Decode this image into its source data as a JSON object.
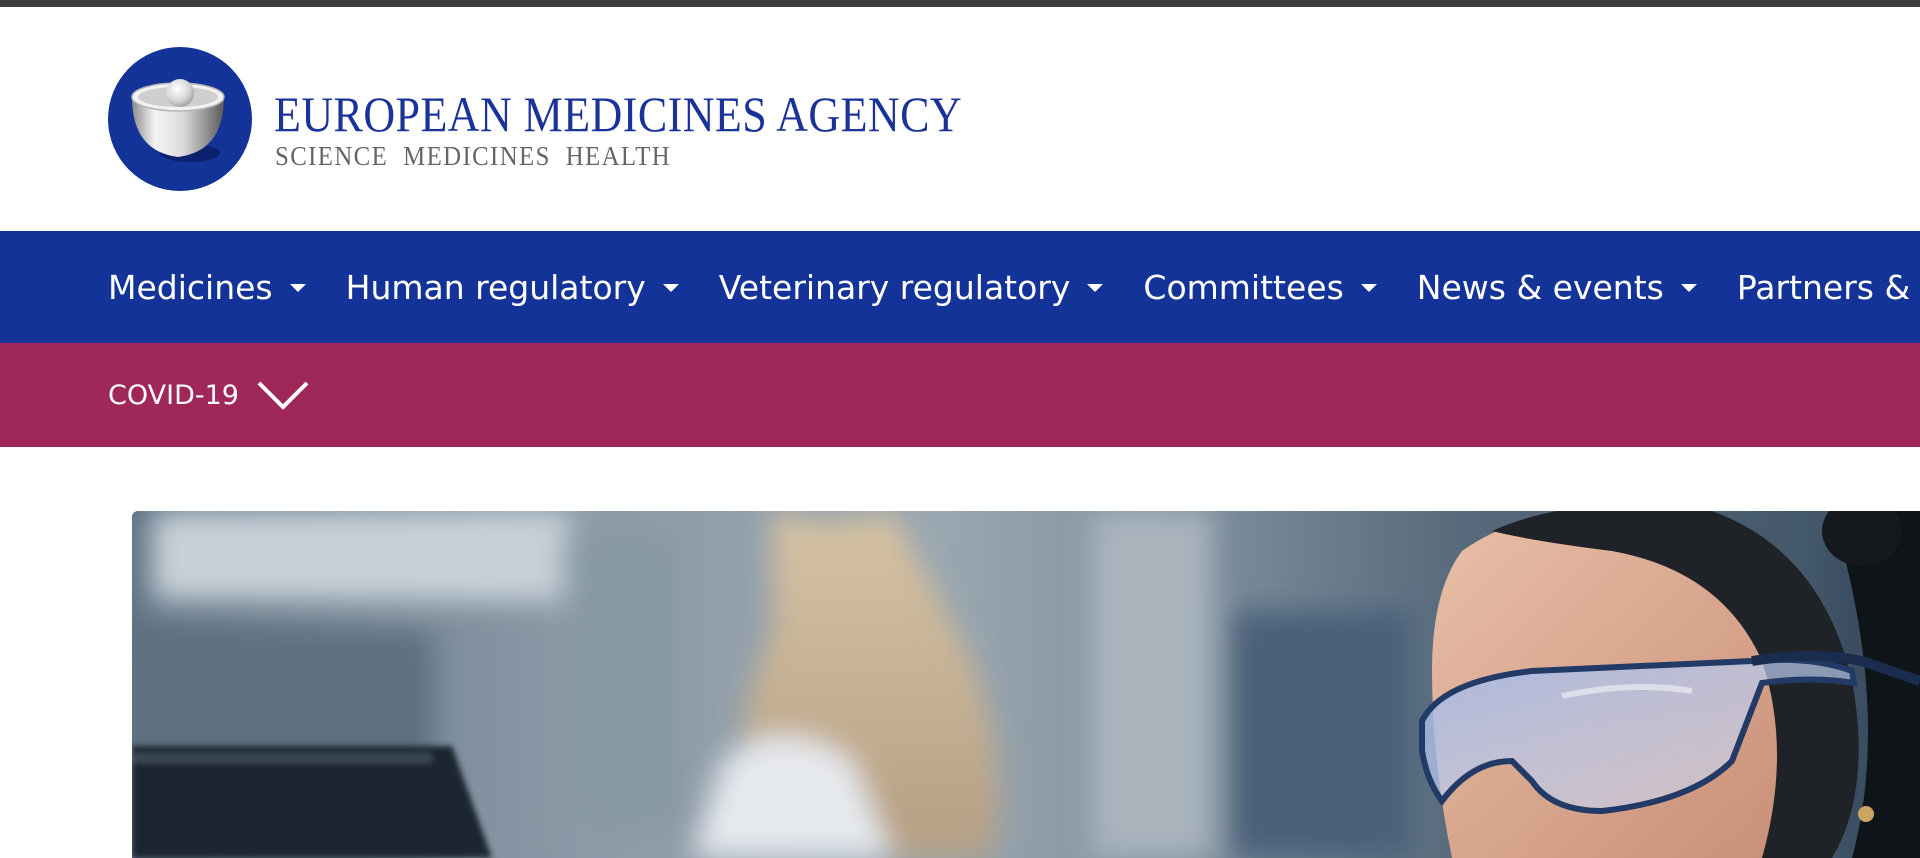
{
  "site": {
    "logo": {
      "title": "EUROPEAN MEDICINES AGENCY",
      "tagline": "SCIENCE  MEDICINES  HEALTH",
      "emblem_icon": "ema-bowl-emblem-icon"
    }
  },
  "nav": {
    "items": [
      {
        "label": "Medicines"
      },
      {
        "label": "Human regulatory"
      },
      {
        "label": "Veterinary regulatory"
      },
      {
        "label": "Committees"
      },
      {
        "label": "News & events"
      },
      {
        "label": "Partners & networks"
      }
    ],
    "caret_icon": "caret-down-icon"
  },
  "covid": {
    "label": "COVID-19",
    "chevron_icon": "chevron-down-icon"
  },
  "hero": {
    "image_icon": "hero-photo-lab-scientist"
  },
  "colors": {
    "brand_blue": "#133399",
    "covid_magenta": "#a0275a",
    "top_strip": "#3d3d3d",
    "tagline_grey": "#666666"
  }
}
